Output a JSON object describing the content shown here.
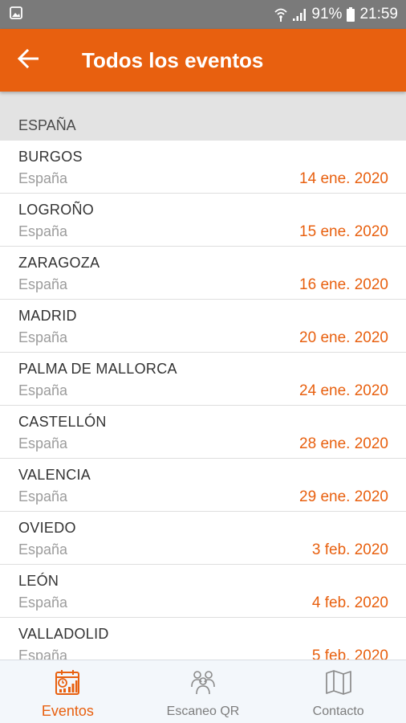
{
  "colors": {
    "accent": "#e8600f",
    "statusbar": "#7a7a7a",
    "section_bg": "#e3e3e3"
  },
  "statusbar": {
    "battery": "91%",
    "time": "21:59"
  },
  "header": {
    "title": "Todos los eventos",
    "back_icon": "arrow-left-icon"
  },
  "section": {
    "title": "ESPAÑA"
  },
  "events": [
    {
      "city": "BURGOS",
      "country": "España",
      "date": "14 ene. 2020"
    },
    {
      "city": "LOGROÑO",
      "country": "España",
      "date": "15 ene. 2020"
    },
    {
      "city": "ZARAGOZA",
      "country": "España",
      "date": "16 ene. 2020"
    },
    {
      "city": "MADRID",
      "country": "España",
      "date": "20 ene. 2020"
    },
    {
      "city": "PALMA DE MALLORCA",
      "country": "España",
      "date": "24 ene. 2020"
    },
    {
      "city": "CASTELLÓN",
      "country": "España",
      "date": "28 ene. 2020"
    },
    {
      "city": "VALENCIA",
      "country": "España",
      "date": "29 ene. 2020"
    },
    {
      "city": "OVIEDO",
      "country": "España",
      "date": "3 feb. 2020"
    },
    {
      "city": "LEÓN",
      "country": "España",
      "date": "4 feb. 2020"
    },
    {
      "city": "VALLADOLID",
      "country": "España",
      "date": "5 feb. 2020"
    }
  ],
  "bottom_nav": {
    "items": [
      {
        "label": "Eventos",
        "icon": "calendar-chart-icon",
        "active": true
      },
      {
        "label": "Escaneo QR",
        "icon": "people-scan-icon",
        "active": false
      },
      {
        "label": "Contacto",
        "icon": "map-icon",
        "active": false
      }
    ]
  }
}
